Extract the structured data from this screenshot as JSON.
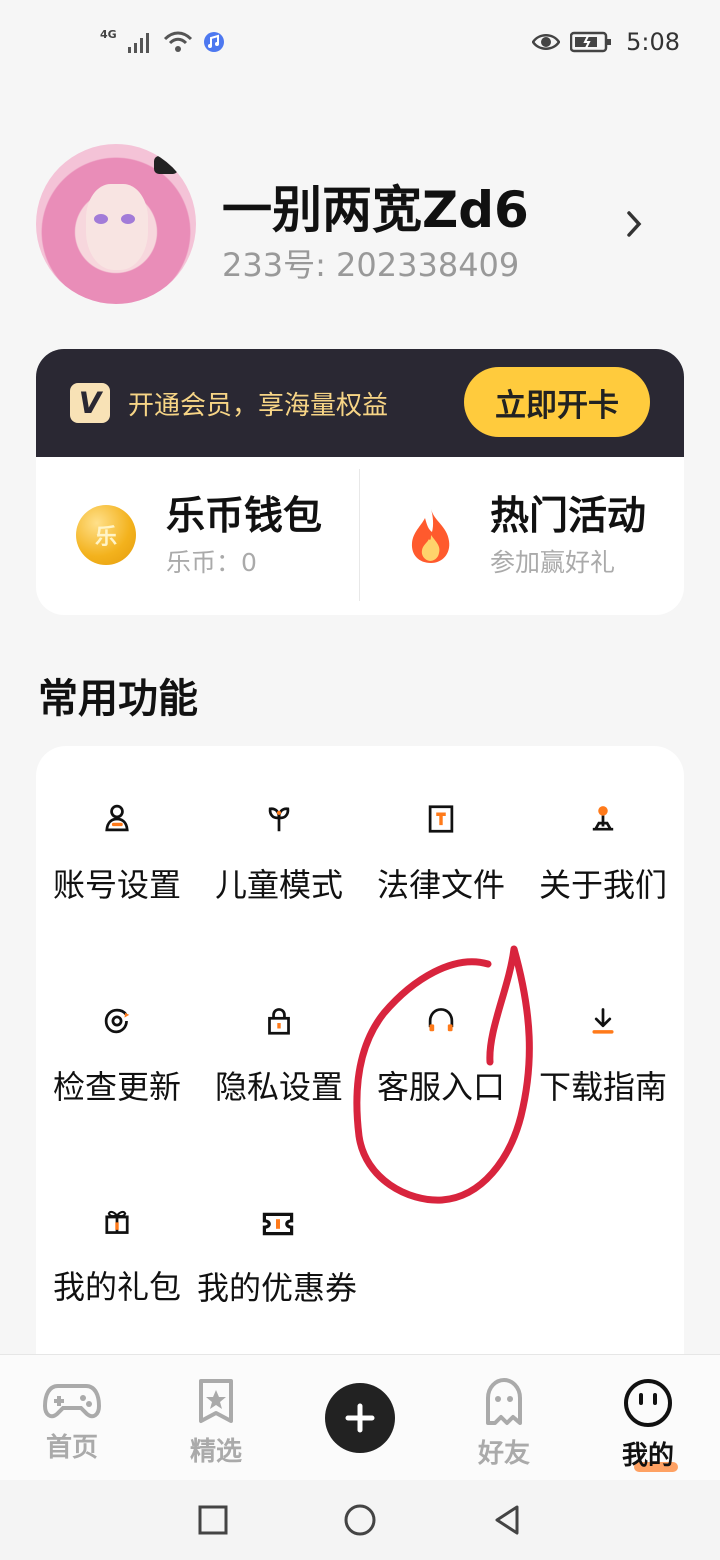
{
  "status": {
    "signal": "4G",
    "time": "5:08"
  },
  "profile": {
    "username": "一别两宽Zd6",
    "user_id": "233号: 202338409"
  },
  "vip": {
    "logo": "V",
    "promo_text": "开通会员，享海量权益",
    "button_label": "立即开卡"
  },
  "wallet": {
    "coin_title": "乐币钱包",
    "coin_symbol": "乐",
    "coin_sub": "乐币：0",
    "event_title": "热门活动",
    "event_sub": "参加赢好礼"
  },
  "section": {
    "common_functions": "常用功能"
  },
  "features": [
    {
      "label": "账号设置",
      "icon": "user-icon"
    },
    {
      "label": "儿童模式",
      "icon": "sprout-icon"
    },
    {
      "label": "法律文件",
      "icon": "document-icon"
    },
    {
      "label": "关于我们",
      "icon": "joystick-icon"
    },
    {
      "label": "检查更新",
      "icon": "refresh-icon"
    },
    {
      "label": "隐私设置",
      "icon": "lock-icon"
    },
    {
      "label": "客服入口",
      "icon": "headset-icon"
    },
    {
      "label": "下载指南",
      "icon": "download-icon"
    },
    {
      "label": "我的礼包",
      "icon": "gift-icon"
    },
    {
      "label": "我的优惠券",
      "icon": "ticket-icon"
    }
  ],
  "tabs": [
    {
      "label": "首页",
      "icon": "gamepad-icon",
      "active": false
    },
    {
      "label": "精选",
      "icon": "star-bookmark-icon",
      "active": false
    },
    {
      "label": "",
      "icon": "plus-icon",
      "active": false
    },
    {
      "label": "好友",
      "icon": "ghost-icon",
      "active": false
    },
    {
      "label": "我的",
      "icon": "face-icon",
      "active": true
    }
  ],
  "colors": {
    "accent": "#ff8b3d",
    "vip_background": "#2a2833",
    "vip_gold": "#f7d586",
    "vip_button": "#ffcb3d",
    "annotation_red": "#d8243d"
  }
}
